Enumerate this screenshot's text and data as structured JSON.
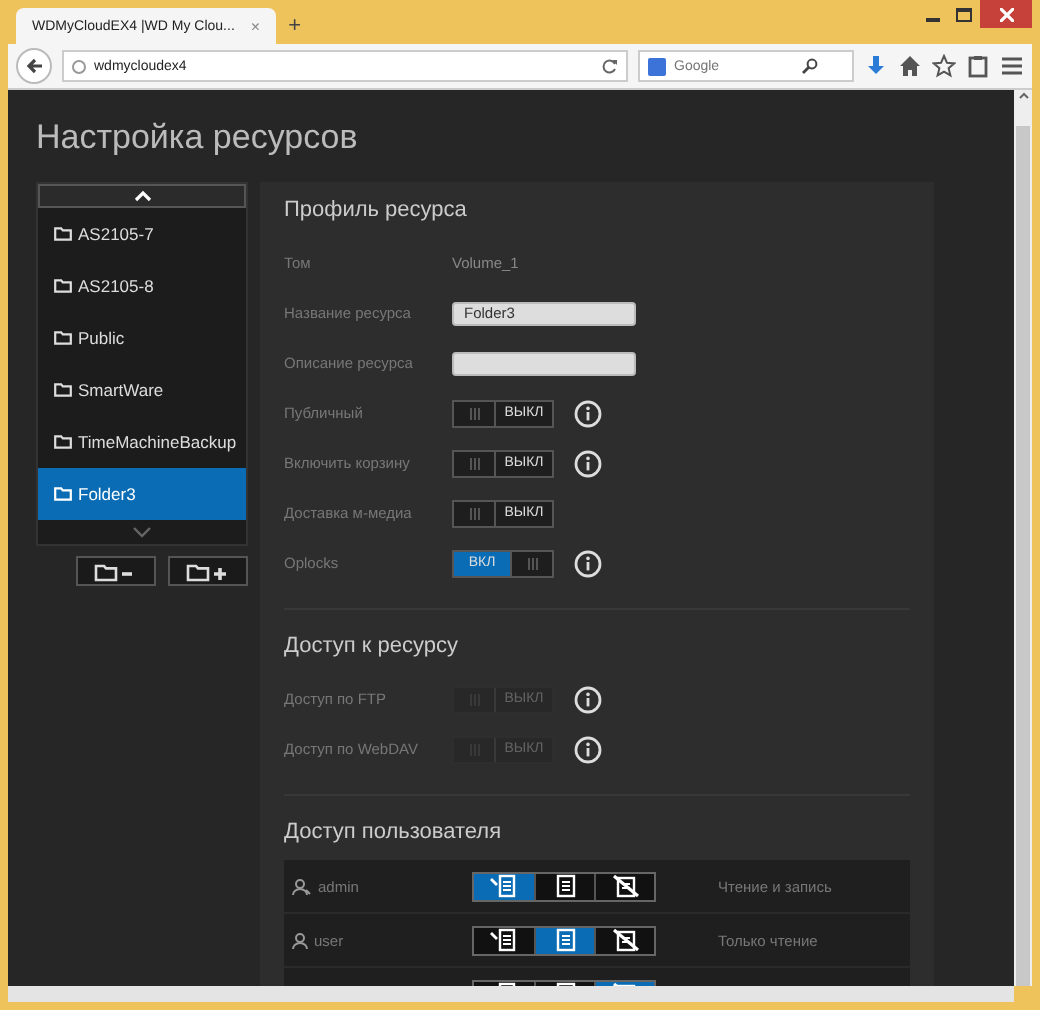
{
  "browser": {
    "tab_title": "WDMyCloudEX4 |WD My Clou...",
    "tab_close": "×",
    "new_tab": "+",
    "url": "wdmycloudex4",
    "search_placeholder": "Google"
  },
  "page_title": "Настройка ресурсов",
  "shares": [
    {
      "name": "AS2105-7",
      "selected": false
    },
    {
      "name": "AS2105-8",
      "selected": false
    },
    {
      "name": "Public",
      "selected": false
    },
    {
      "name": "SmartWare",
      "selected": false
    },
    {
      "name": "TimeMachineBackup",
      "selected": false
    },
    {
      "name": "Folder3",
      "selected": true
    }
  ],
  "profile": {
    "title": "Профиль ресурса",
    "rows": [
      {
        "kind": "text",
        "label": "Том",
        "value": "Volume_1"
      },
      {
        "kind": "field",
        "label": "Название ресурса",
        "value": "Folder3"
      },
      {
        "kind": "field",
        "label": "Описание ресурса"
      },
      {
        "kind": "toggle",
        "label": "Публичный",
        "on": false,
        "disabled": false,
        "state_text": "ВЫКЛ",
        "info": true
      },
      {
        "kind": "toggle",
        "label": "Включить корзину",
        "on": false,
        "disabled": false,
        "state_text": "ВЫКЛ",
        "info": true
      },
      {
        "kind": "toggle",
        "label": "Доставка м-медиа",
        "on": false,
        "disabled": false,
        "state_text": "ВЫКЛ",
        "info": false
      },
      {
        "kind": "toggle",
        "label": "Oplocks",
        "on": true,
        "disabled": false,
        "state_text": "ВКЛ",
        "info": true
      }
    ]
  },
  "access": {
    "title": "Доступ к ресурсу",
    "rows": [
      {
        "kind": "toggle",
        "label": "Доступ по FTP",
        "on": false,
        "disabled": true,
        "state_text": "ВЫКЛ",
        "info": true
      },
      {
        "kind": "toggle",
        "label": "Доступ по WebDAV",
        "on": false,
        "disabled": true,
        "state_text": "ВЫКЛ",
        "info": true
      }
    ]
  },
  "user_access": {
    "title": "Доступ пользователя",
    "users": [
      {
        "kind": "admin",
        "name": "admin",
        "permissions": [
          {
            "kind": "read_write",
            "selected": true
          },
          {
            "kind": "read",
            "selected": false
          },
          {
            "kind": "deny",
            "selected": false
          }
        ],
        "status": "Чтение и запись"
      },
      {
        "kind": "user",
        "name": "user",
        "permissions": [
          {
            "kind": "read_write",
            "selected": false
          },
          {
            "kind": "read",
            "selected": true
          },
          {
            "kind": "deny",
            "selected": false
          }
        ],
        "status": "Только чтение"
      },
      {
        "permissions": [
          {
            "kind": "read_write",
            "selected": false
          },
          {
            "kind": "read",
            "selected": false
          },
          {
            "kind": "deny",
            "selected": true
          }
        ]
      }
    ]
  }
}
